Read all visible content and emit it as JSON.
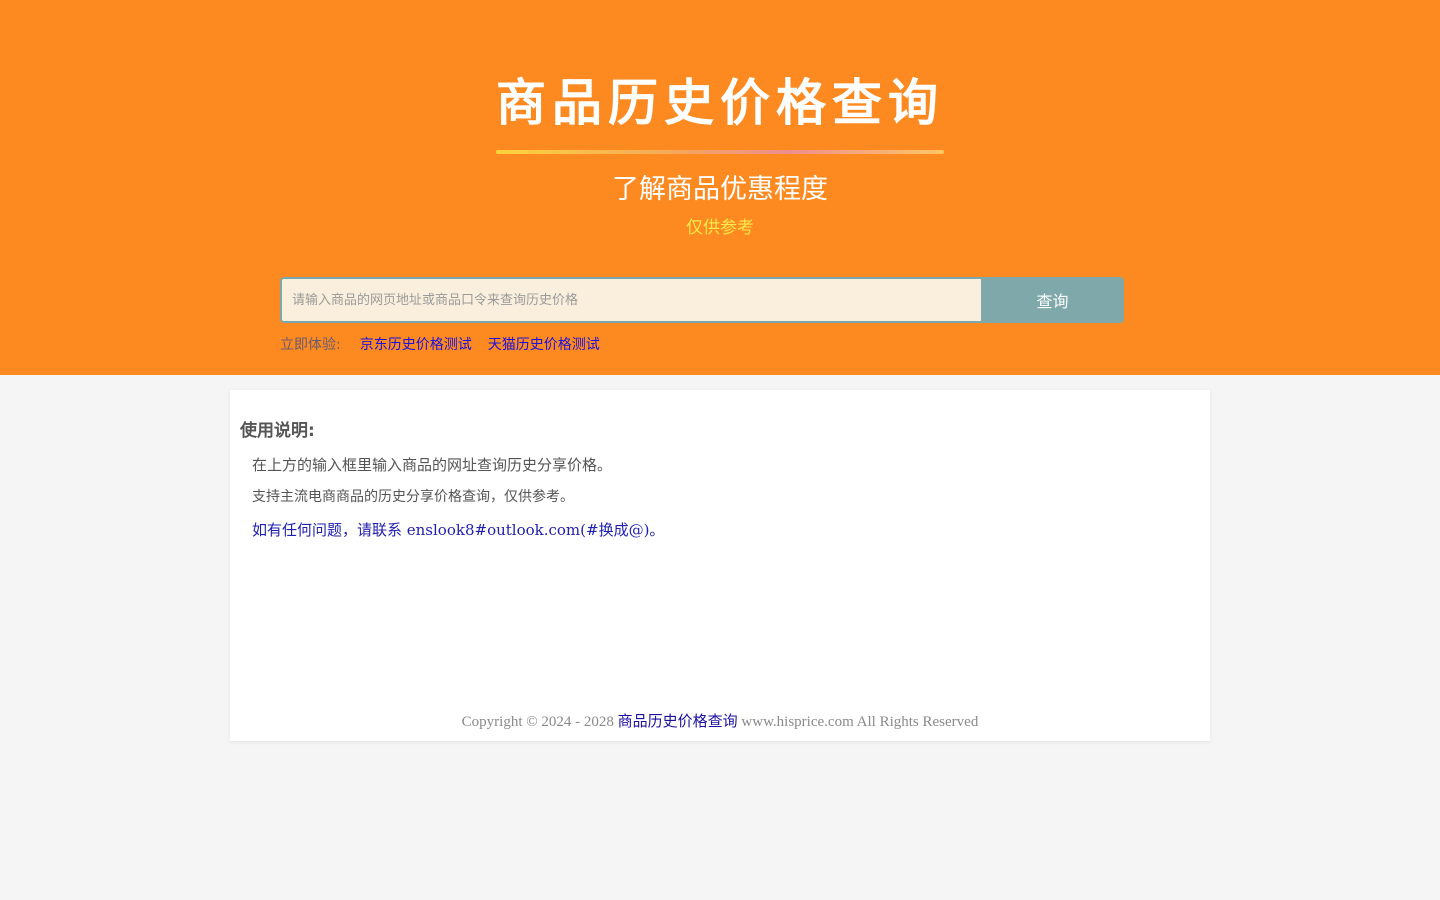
{
  "hero": {
    "title": "商品历史价格查询",
    "subtitle": "了解商品优惠程度",
    "note": "仅供参考"
  },
  "search": {
    "placeholder": "请输入商品的网页地址或商品口令来查询历史价格",
    "value": "",
    "button_label": "查询"
  },
  "try_row": {
    "label": "立即体验:",
    "links": [
      "京东历史价格测试",
      "天猫历史价格测试"
    ]
  },
  "usage": {
    "heading": "使用说明:",
    "lines": [
      "在上方的输入框里输入商品的网址查询历史分享价格。",
      "支持主流电商商品的历史分享价格查询，仅供参考。",
      "如有任何问题，请联系 enslook8#outlook.com(#换成@)。"
    ]
  },
  "footer": {
    "prefix": "Copyright © 2024 - 2028",
    "link": "商品历史价格查询",
    "suffix": "www.hisprice.com All Rights Reserved"
  },
  "colors": {
    "hero_bg": "#fd8a20",
    "page_bg": "#f5f5f5",
    "note": "#fbe94a",
    "input_bg": "#faefdc",
    "button_bg": "#7fa8aa",
    "link": "#1c10e0"
  }
}
